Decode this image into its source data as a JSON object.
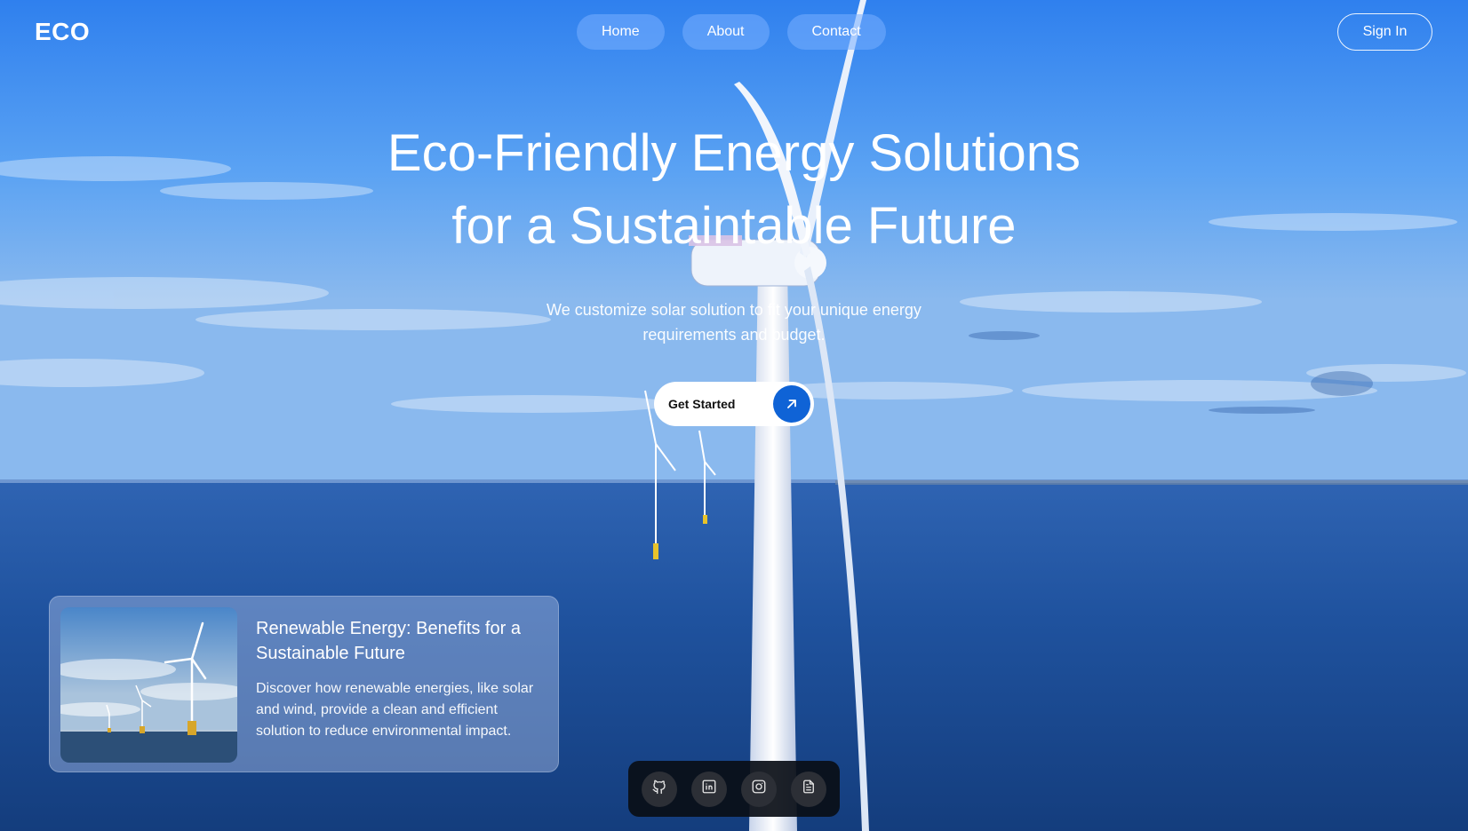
{
  "brand": {
    "logo": "ECO"
  },
  "nav": {
    "items": [
      "Home",
      "About",
      "Contact"
    ]
  },
  "auth": {
    "sign_in_label": "Sign In"
  },
  "hero": {
    "title_line1": "Eco-Friendly Energy Solutions",
    "title_line2": "for a Sustaintable Future",
    "subtitle": "We customize solar solution to fit your unique energy requirements and budget.",
    "cta_label": "Get Started",
    "cta_icon": "arrow-up-right-icon"
  },
  "card": {
    "title": "Renewable Energy: Benefits for a Sustainable Future",
    "description": "Discover how renewable energies, like solar and wind, provide a clean and efficient solution to reduce environmental impact."
  },
  "dock": {
    "icons": [
      "github-icon",
      "linkedin-icon",
      "instagram-icon",
      "document-icon"
    ]
  },
  "colors": {
    "accent": "#0f63d6",
    "sky_top": "#3f8cf0",
    "sea": "#1d4f9c"
  }
}
